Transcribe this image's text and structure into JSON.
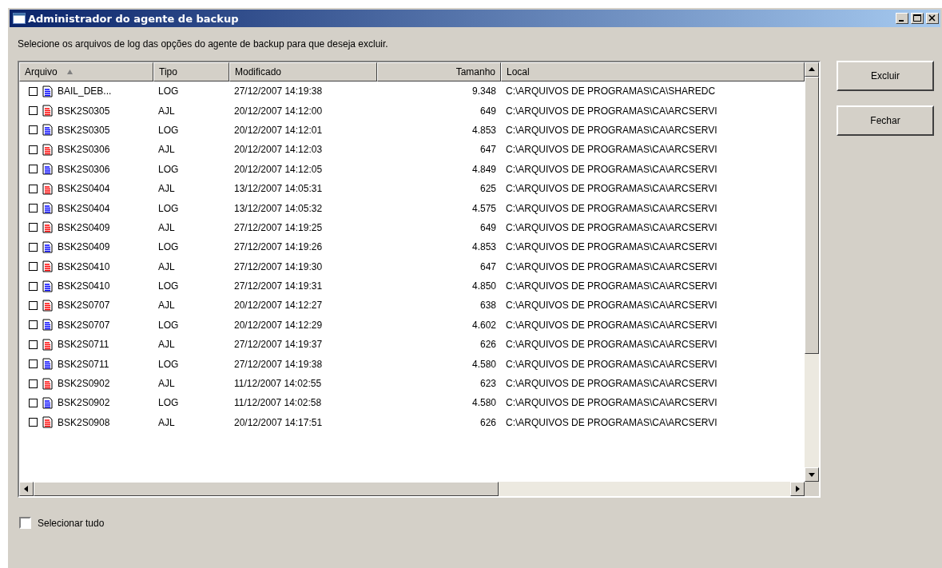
{
  "window": {
    "title": "Administrador do agente de backup"
  },
  "instruction": "Selecione os arquivos de log das opções do agente de backup para que deseja excluir.",
  "table": {
    "columns": [
      {
        "label": "Arquivo",
        "sorted": true
      },
      {
        "label": "Tipo",
        "sorted": false
      },
      {
        "label": "Modificado",
        "sorted": false
      },
      {
        "label": "Tamanho",
        "sorted": false
      },
      {
        "label": "Local",
        "sorted": false
      }
    ],
    "rows": [
      {
        "checked": false,
        "color": "#0000ff",
        "cells": [
          "BAIL_DEB...",
          "LOG",
          "27/12/2007 14:19:38",
          "9.348",
          "C:\\ARQUIVOS DE PROGRAMAS\\CA\\SHAREDC"
        ]
      },
      {
        "checked": false,
        "color": "#ff0000",
        "cells": [
          "BSK2S0305",
          "AJL",
          "20/12/2007 14:12:00",
          "649",
          "C:\\ARQUIVOS DE PROGRAMAS\\CA\\ARCSERVI"
        ]
      },
      {
        "checked": false,
        "color": "#0000ff",
        "cells": [
          "BSK2S0305",
          "LOG",
          "20/12/2007 14:12:01",
          "4.853",
          "C:\\ARQUIVOS DE PROGRAMAS\\CA\\ARCSERVI"
        ]
      },
      {
        "checked": false,
        "color": "#ff0000",
        "cells": [
          "BSK2S0306",
          "AJL",
          "20/12/2007 14:12:03",
          "647",
          "C:\\ARQUIVOS DE PROGRAMAS\\CA\\ARCSERVI"
        ]
      },
      {
        "checked": false,
        "color": "#0000ff",
        "cells": [
          "BSK2S0306",
          "LOG",
          "20/12/2007 14:12:05",
          "4.849",
          "C:\\ARQUIVOS DE PROGRAMAS\\CA\\ARCSERVI"
        ]
      },
      {
        "checked": false,
        "color": "#ff0000",
        "cells": [
          "BSK2S0404",
          "AJL",
          "13/12/2007 14:05:31",
          "625",
          "C:\\ARQUIVOS DE PROGRAMAS\\CA\\ARCSERVI"
        ]
      },
      {
        "checked": false,
        "color": "#0000ff",
        "cells": [
          "BSK2S0404",
          "LOG",
          "13/12/2007 14:05:32",
          "4.575",
          "C:\\ARQUIVOS DE PROGRAMAS\\CA\\ARCSERVI"
        ]
      },
      {
        "checked": false,
        "color": "#ff0000",
        "cells": [
          "BSK2S0409",
          "AJL",
          "27/12/2007 14:19:25",
          "649",
          "C:\\ARQUIVOS DE PROGRAMAS\\CA\\ARCSERVI"
        ]
      },
      {
        "checked": false,
        "color": "#0000ff",
        "cells": [
          "BSK2S0409",
          "LOG",
          "27/12/2007 14:19:26",
          "4.853",
          "C:\\ARQUIVOS DE PROGRAMAS\\CA\\ARCSERVI"
        ]
      },
      {
        "checked": false,
        "color": "#ff0000",
        "cells": [
          "BSK2S0410",
          "AJL",
          "27/12/2007 14:19:30",
          "647",
          "C:\\ARQUIVOS DE PROGRAMAS\\CA\\ARCSERVI"
        ]
      },
      {
        "checked": false,
        "color": "#0000ff",
        "cells": [
          "BSK2S0410",
          "LOG",
          "27/12/2007 14:19:31",
          "4.850",
          "C:\\ARQUIVOS DE PROGRAMAS\\CA\\ARCSERVI"
        ]
      },
      {
        "checked": false,
        "color": "#ff0000",
        "cells": [
          "BSK2S0707",
          "AJL",
          "20/12/2007 14:12:27",
          "638",
          "C:\\ARQUIVOS DE PROGRAMAS\\CA\\ARCSERVI"
        ]
      },
      {
        "checked": false,
        "color": "#0000ff",
        "cells": [
          "BSK2S0707",
          "LOG",
          "20/12/2007 14:12:29",
          "4.602",
          "C:\\ARQUIVOS DE PROGRAMAS\\CA\\ARCSERVI"
        ]
      },
      {
        "checked": false,
        "color": "#ff0000",
        "cells": [
          "BSK2S0711",
          "AJL",
          "27/12/2007 14:19:37",
          "626",
          "C:\\ARQUIVOS DE PROGRAMAS\\CA\\ARCSERVI"
        ]
      },
      {
        "checked": false,
        "color": "#0000ff",
        "cells": [
          "BSK2S0711",
          "LOG",
          "27/12/2007 14:19:38",
          "4.580",
          "C:\\ARQUIVOS DE PROGRAMAS\\CA\\ARCSERVI"
        ]
      },
      {
        "checked": false,
        "color": "#ff0000",
        "cells": [
          "BSK2S0902",
          "AJL",
          "11/12/2007 14:02:55",
          "623",
          "C:\\ARQUIVOS DE PROGRAMAS\\CA\\ARCSERVI"
        ]
      },
      {
        "checked": false,
        "color": "#0000ff",
        "cells": [
          "BSK2S0902",
          "LOG",
          "11/12/2007 14:02:58",
          "4.580",
          "C:\\ARQUIVOS DE PROGRAMAS\\CA\\ARCSERVI"
        ]
      },
      {
        "checked": false,
        "color": "#ff0000",
        "cells": [
          "BSK2S0908",
          "AJL",
          "20/12/2007 14:17:51",
          "626",
          "C:\\ARQUIVOS DE PROGRAMAS\\CA\\ARCSERVI"
        ]
      }
    ]
  },
  "buttons": [
    "Excluir",
    "Fechar"
  ],
  "select_all": {
    "label": "Selecionar tudo",
    "checked": false
  }
}
